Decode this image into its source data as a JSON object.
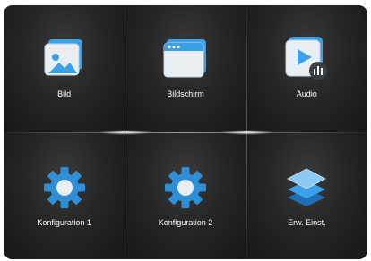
{
  "menu": {
    "tiles": [
      {
        "label": "Bild",
        "icon": "picture-icon"
      },
      {
        "label": "Bildschirm",
        "icon": "screen-window-icon"
      },
      {
        "label": "Audio",
        "icon": "audio-play-icon"
      },
      {
        "label": "Konfiguration 1",
        "icon": "gear-icon"
      },
      {
        "label": "Konfiguration 2",
        "icon": "gear-icon"
      },
      {
        "label": "Erw. Einst.",
        "icon": "layers-icon"
      }
    ]
  },
  "colors": {
    "accent_blue": "#3aa0e8",
    "background": "#1a1a1a",
    "label_text": "#ffffff"
  }
}
